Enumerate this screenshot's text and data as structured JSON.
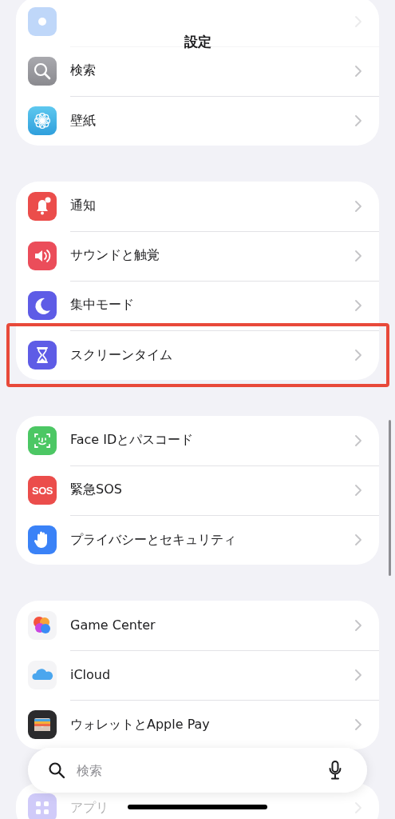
{
  "title": "設定",
  "groups": [
    {
      "items": [
        {
          "kind": "display",
          "dimmed": true,
          "highlighted": false
        },
        {
          "kind": "search",
          "label": "検索",
          "dimmed": false,
          "highlighted": false
        },
        {
          "kind": "wallpaper",
          "label": "壁紙",
          "dimmed": false,
          "highlighted": false
        }
      ]
    },
    {
      "items": [
        {
          "kind": "bell",
          "label": "通知",
          "dimmed": false,
          "highlighted": false
        },
        {
          "kind": "sound",
          "label": "サウンドと触覚",
          "dimmed": false,
          "highlighted": false
        },
        {
          "kind": "moon",
          "label": "集中モード",
          "dimmed": false,
          "highlighted": false
        },
        {
          "kind": "hourglass",
          "label": "スクリーンタイム",
          "dimmed": false,
          "highlighted": true
        }
      ]
    },
    {
      "items": [
        {
          "kind": "faceid",
          "label": "Face IDとパスコード",
          "dimmed": false,
          "highlighted": false
        },
        {
          "kind": "sos",
          "icon_text": "SOS",
          "label": "緊急SOS",
          "dimmed": false,
          "highlighted": false
        },
        {
          "kind": "hand",
          "label": "プライバシーとセキュリティ",
          "dimmed": false,
          "highlighted": false
        }
      ]
    },
    {
      "items": [
        {
          "kind": "gamecenter",
          "label": "Game Center",
          "dimmed": false,
          "highlighted": false
        },
        {
          "kind": "icloud",
          "label": "iCloud",
          "dimmed": false,
          "highlighted": false
        },
        {
          "kind": "wallet",
          "label": "ウォレットとApple Pay",
          "dimmed": false,
          "highlighted": false
        }
      ]
    },
    {
      "items": [
        {
          "kind": "apps",
          "label": "アプリ",
          "dimmed": true,
          "highlighted": false
        }
      ]
    }
  ],
  "search": {
    "placeholder": "検索"
  }
}
